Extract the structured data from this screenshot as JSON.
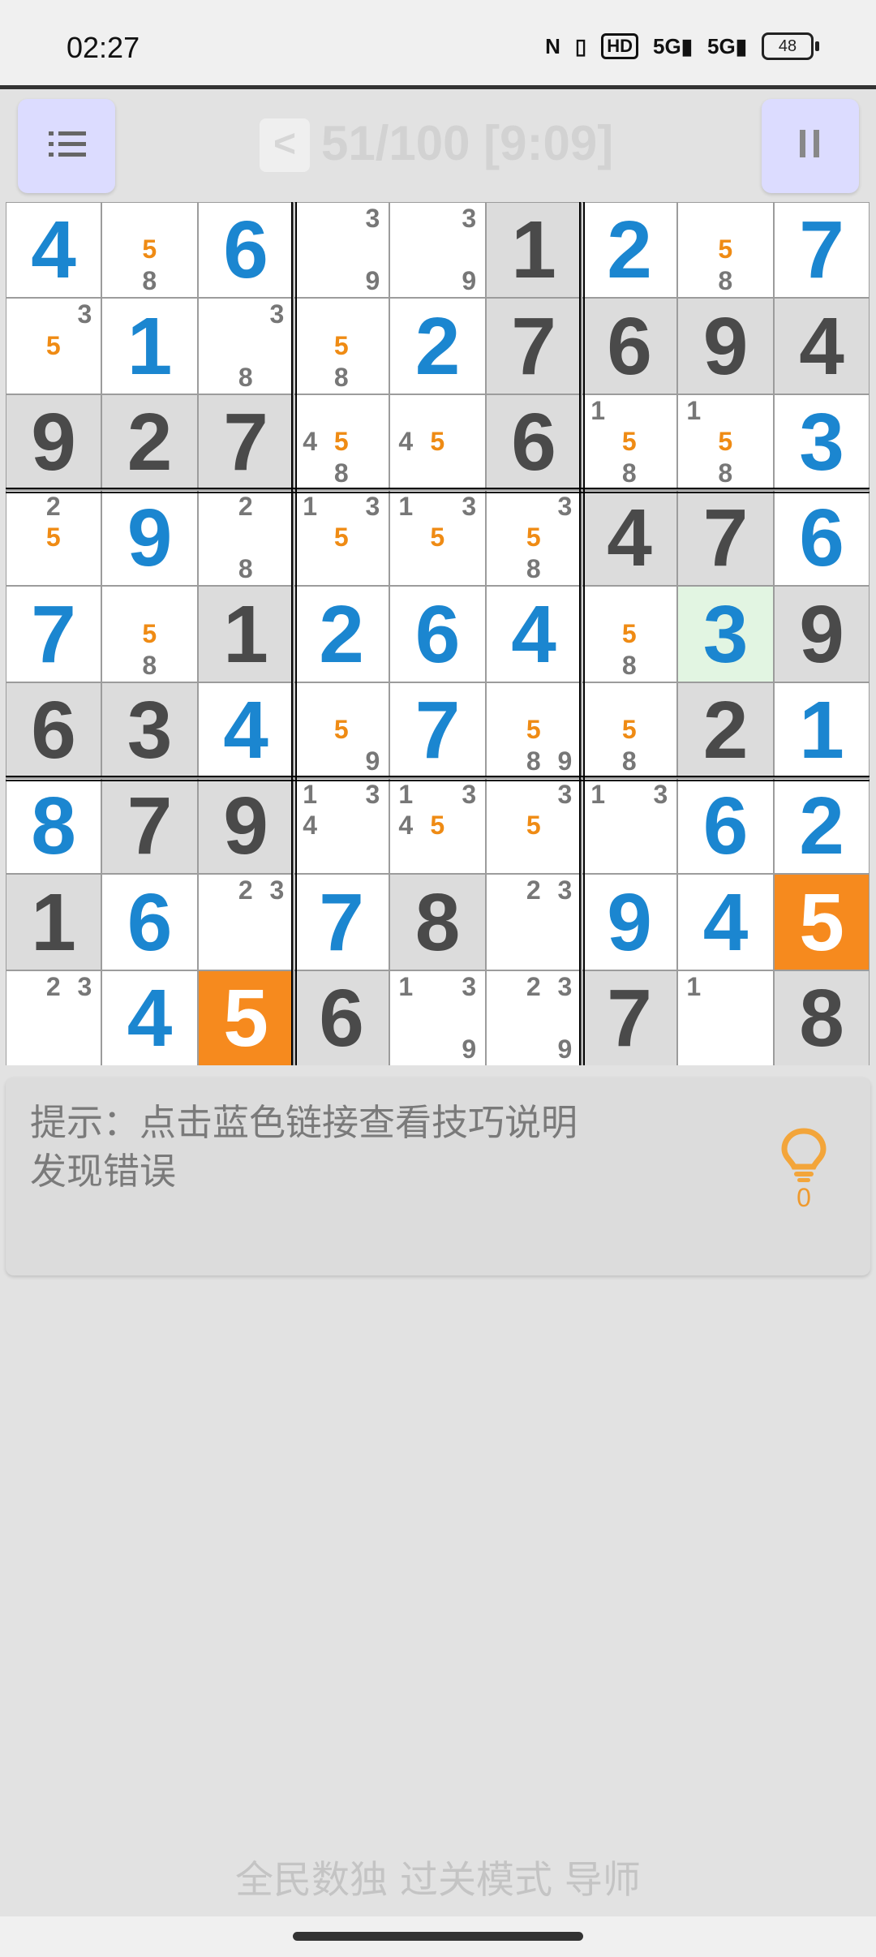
{
  "status_bar": {
    "time": "02:27",
    "network_1": "5G",
    "network_2": "5G",
    "hd_badge": "HD",
    "battery": "48"
  },
  "header": {
    "prev_label": "<",
    "level_status": "51/100 [9:09]",
    "menu_icon": "list-icon",
    "pause_icon": "pause-icon"
  },
  "board": {
    "cells": [
      [
        {
          "v": "4",
          "t": "user"
        },
        {
          "pm": [
            "5",
            "8"
          ],
          "hl": [
            "5"
          ]
        },
        {
          "v": "6",
          "t": "user"
        },
        {
          "pm": [
            "3",
            "9"
          ]
        },
        {
          "pm": [
            "3",
            "9"
          ]
        },
        {
          "v": "1",
          "t": "given"
        },
        {
          "v": "2",
          "t": "user"
        },
        {
          "pm": [
            "5",
            "8"
          ],
          "hl": [
            "5"
          ]
        },
        {
          "v": "7",
          "t": "user"
        }
      ],
      [
        {
          "pm": [
            "3",
            "5"
          ],
          "hl": [
            "5"
          ]
        },
        {
          "v": "1",
          "t": "user"
        },
        {
          "pm": [
            "3",
            "8"
          ]
        },
        {
          "pm": [
            "5",
            "8"
          ],
          "hl": [
            "5"
          ]
        },
        {
          "v": "2",
          "t": "user"
        },
        {
          "v": "7",
          "t": "given"
        },
        {
          "v": "6",
          "t": "given"
        },
        {
          "v": "9",
          "t": "given"
        },
        {
          "v": "4",
          "t": "given"
        }
      ],
      [
        {
          "v": "9",
          "t": "given"
        },
        {
          "v": "2",
          "t": "given"
        },
        {
          "v": "7",
          "t": "given"
        },
        {
          "pm": [
            "4",
            "5",
            "8"
          ],
          "hl": [
            "5"
          ]
        },
        {
          "pm": [
            "4",
            "5"
          ],
          "hl": [
            "5"
          ]
        },
        {
          "v": "6",
          "t": "given"
        },
        {
          "pm": [
            "1",
            "5",
            "8"
          ],
          "hl": [
            "5"
          ]
        },
        {
          "pm": [
            "1",
            "5",
            "8"
          ],
          "hl": [
            "5"
          ]
        },
        {
          "v": "3",
          "t": "user"
        }
      ],
      [
        {
          "pm": [
            "2",
            "5"
          ],
          "hl": [
            "5"
          ]
        },
        {
          "v": "9",
          "t": "user"
        },
        {
          "pm": [
            "2",
            "8"
          ]
        },
        {
          "pm": [
            "1",
            "3",
            "5"
          ],
          "hl": [
            "5"
          ]
        },
        {
          "pm": [
            "1",
            "3",
            "5"
          ],
          "hl": [
            "5"
          ]
        },
        {
          "pm": [
            "3",
            "5",
            "8"
          ],
          "hl": [
            "5"
          ]
        },
        {
          "v": "4",
          "t": "given"
        },
        {
          "v": "7",
          "t": "given"
        },
        {
          "v": "6",
          "t": "user"
        }
      ],
      [
        {
          "v": "7",
          "t": "user"
        },
        {
          "pm": [
            "5",
            "8"
          ],
          "hl": [
            "5"
          ]
        },
        {
          "v": "1",
          "t": "given"
        },
        {
          "v": "2",
          "t": "user"
        },
        {
          "v": "6",
          "t": "user"
        },
        {
          "v": "4",
          "t": "user"
        },
        {
          "pm": [
            "5",
            "8"
          ],
          "hl": [
            "5"
          ]
        },
        {
          "v": "3",
          "t": "user",
          "bg": "green"
        },
        {
          "v": "9",
          "t": "given"
        }
      ],
      [
        {
          "v": "6",
          "t": "given"
        },
        {
          "v": "3",
          "t": "given"
        },
        {
          "v": "4",
          "t": "user"
        },
        {
          "pm": [
            "5",
            "9"
          ],
          "hl": [
            "5"
          ]
        },
        {
          "v": "7",
          "t": "user"
        },
        {
          "pm": [
            "5",
            "8",
            "9"
          ],
          "hl": [
            "5"
          ]
        },
        {
          "pm": [
            "5",
            "8"
          ],
          "hl": [
            "5"
          ]
        },
        {
          "v": "2",
          "t": "given"
        },
        {
          "v": "1",
          "t": "user"
        }
      ],
      [
        {
          "v": "8",
          "t": "user"
        },
        {
          "v": "7",
          "t": "given"
        },
        {
          "v": "9",
          "t": "given"
        },
        {
          "pm": [
            "1",
            "3",
            "4"
          ]
        },
        {
          "pm": [
            "1",
            "3",
            "4",
            "5"
          ],
          "hl": [
            "5"
          ]
        },
        {
          "pm": [
            "3",
            "5"
          ],
          "hl": [
            "5"
          ]
        },
        {
          "pm": [
            "1",
            "3"
          ]
        },
        {
          "v": "6",
          "t": "user"
        },
        {
          "v": "2",
          "t": "user"
        }
      ],
      [
        {
          "v": "1",
          "t": "given"
        },
        {
          "v": "6",
          "t": "user"
        },
        {
          "pm": [
            "2",
            "3"
          ]
        },
        {
          "v": "7",
          "t": "user"
        },
        {
          "v": "8",
          "t": "given"
        },
        {
          "pm": [
            "2",
            "3"
          ]
        },
        {
          "v": "9",
          "t": "user"
        },
        {
          "v": "4",
          "t": "user"
        },
        {
          "v": "5",
          "t": "user",
          "bg": "orange"
        }
      ],
      [
        {
          "pm": [
            "2",
            "3"
          ]
        },
        {
          "v": "4",
          "t": "user"
        },
        {
          "v": "5",
          "t": "user",
          "bg": "orange"
        },
        {
          "v": "6",
          "t": "given"
        },
        {
          "pm": [
            "1",
            "3",
            "9"
          ]
        },
        {
          "pm": [
            "2",
            "3",
            "9"
          ]
        },
        {
          "v": "7",
          "t": "given"
        },
        {
          "pm": [
            "1"
          ]
        },
        {
          "v": "8",
          "t": "given"
        }
      ]
    ]
  },
  "hint": {
    "line1": "提示：点击蓝色链接查看技巧说明",
    "line2": "发现错误",
    "count": "0",
    "icon": "lightbulb-icon"
  },
  "footer": {
    "title": "全民数独 过关模式 导师"
  },
  "colors": {
    "user_digit": "#1b86d0",
    "given_digit": "#4a4a4a",
    "highlight_candidate": "#ef8b14",
    "selected_cell": "#f68a1e",
    "toolbar_button": "#dcdcff"
  }
}
